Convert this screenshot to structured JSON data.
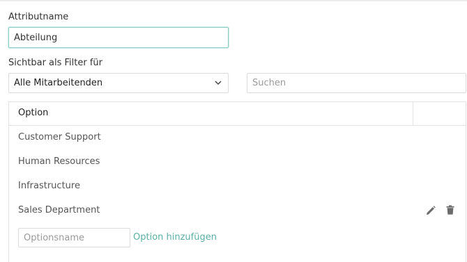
{
  "form": {
    "attribute_name_label": "Attributname",
    "attribute_name_value": "Abteilung",
    "visible_filter_label": "Sichtbar als Filter für",
    "visible_filter_value": "Alle Mitarbeitenden",
    "search_placeholder": "Suchen"
  },
  "table": {
    "header_option": "Option",
    "rows": [
      {
        "label": "Customer Support"
      },
      {
        "label": "Human Resources"
      },
      {
        "label": "Infrastructure"
      },
      {
        "label": "Sales Department"
      }
    ]
  },
  "add_option": {
    "input_placeholder": "Optionsname",
    "link_label": "Option hinzufügen"
  },
  "icons": {
    "edit": "pencil-icon",
    "delete": "trash-icon",
    "dropdown": "chevron-down-icon"
  },
  "colors": {
    "accent": "#5ab0a4",
    "focus_border": "#8ecfc6"
  }
}
